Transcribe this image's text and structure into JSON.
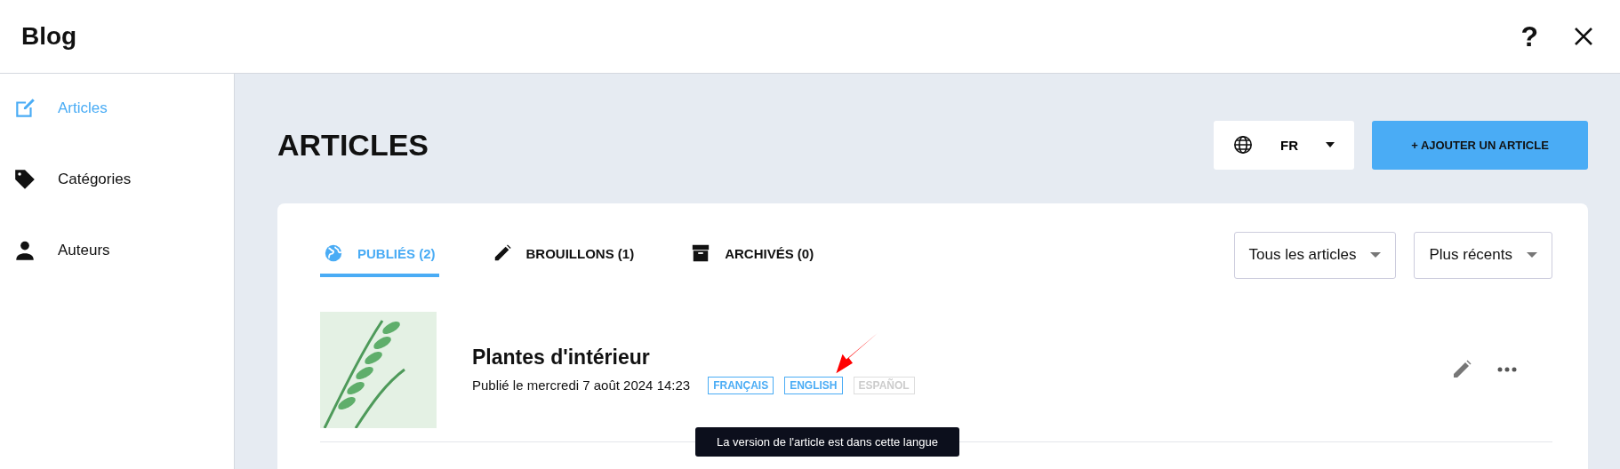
{
  "header": {
    "title": "Blog",
    "help": "?"
  },
  "sidebar": {
    "items": [
      {
        "label": "Articles",
        "kind": "edit",
        "selected": true
      },
      {
        "label": "Catégories",
        "kind": "tag",
        "selected": false
      },
      {
        "label": "Auteurs",
        "kind": "person",
        "selected": false
      }
    ]
  },
  "page": {
    "title": "ARTICLES",
    "language": "FR",
    "add_button": "+ AJOUTER UN ARTICLE"
  },
  "tabs": [
    {
      "label": "PUBLIÉS (2)",
      "kind": "globe",
      "selected": true
    },
    {
      "label": "BROUILLONS (1)",
      "kind": "pencil",
      "selected": false
    },
    {
      "label": "ARCHIVÉS (0)",
      "kind": "archive",
      "selected": false
    }
  ],
  "filters": [
    "Tous les articles",
    "Plus récents"
  ],
  "articles": [
    {
      "title": "Plantes d'intérieur",
      "published": "Publié le mercredi 7 août 2024 14:23",
      "languages": [
        {
          "label": "FRANÇAIS",
          "available": true
        },
        {
          "label": "ENGLISH",
          "available": true
        },
        {
          "label": "ESPAÑOL",
          "available": false
        }
      ],
      "tooltip": "La version de l'article est dans cette langue"
    }
  ]
}
